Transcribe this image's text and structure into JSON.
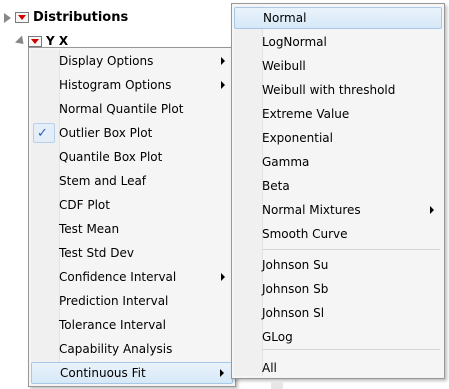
{
  "report": {
    "header": "Distributions",
    "subheader": "Y X"
  },
  "left_menu": {
    "items": [
      {
        "label": "Display Options",
        "submenu": true
      },
      {
        "label": "Histogram Options",
        "submenu": true
      },
      {
        "label": "Normal Quantile Plot",
        "submenu": false
      },
      {
        "label": "Outlier Box Plot",
        "submenu": false,
        "checked": true
      },
      {
        "label": "Quantile Box Plot",
        "submenu": false
      },
      {
        "label": "Stem and Leaf",
        "submenu": false
      },
      {
        "label": "CDF Plot",
        "submenu": false
      },
      {
        "label": "Test Mean",
        "submenu": false
      },
      {
        "label": "Test Std Dev",
        "submenu": false
      },
      {
        "label": "Confidence Interval",
        "submenu": true
      },
      {
        "label": "Prediction Interval",
        "submenu": false
      },
      {
        "label": "Tolerance Interval",
        "submenu": false
      },
      {
        "label": "Capability Analysis",
        "submenu": false
      },
      {
        "label": "Continuous Fit",
        "submenu": true,
        "highlighted": true
      }
    ],
    "check_glyph": "✓"
  },
  "right_menu": {
    "items": [
      {
        "label": "Normal",
        "highlighted": true
      },
      {
        "label": "LogNormal"
      },
      {
        "label": "Weibull"
      },
      {
        "label": "Weibull with threshold"
      },
      {
        "label": "Extreme Value"
      },
      {
        "label": "Exponential"
      },
      {
        "label": "Gamma"
      },
      {
        "label": "Beta"
      },
      {
        "label": "Normal Mixtures",
        "submenu": true
      },
      {
        "label": "Smooth Curve"
      },
      {
        "label": "Johnson Su"
      },
      {
        "label": "Johnson Sb"
      },
      {
        "label": "Johnson Sl"
      },
      {
        "label": "GLog"
      },
      {
        "label": "All"
      }
    ]
  },
  "colors": {
    "red_triangle": "#d40000",
    "highlight": "#d6e8f7",
    "check": "#2b5fb4"
  }
}
